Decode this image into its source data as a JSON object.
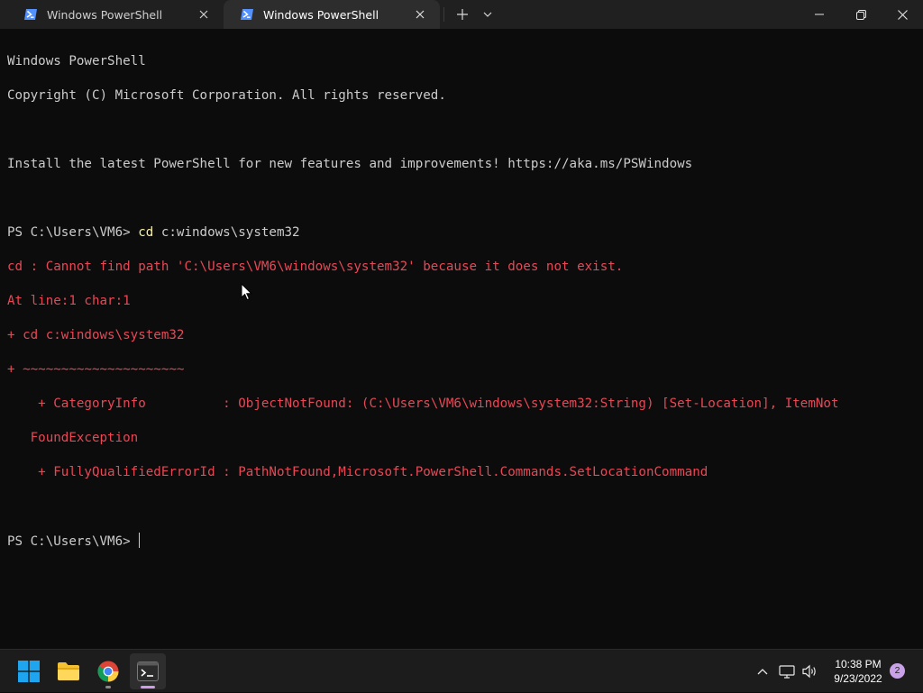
{
  "tabs": [
    {
      "title": "Windows PowerShell",
      "active": false,
      "icon": "powershell-icon"
    },
    {
      "title": "Windows PowerShell",
      "active": true,
      "icon": "powershell-icon"
    }
  ],
  "tabbar": {
    "new_tab_icon": "plus-icon",
    "dropdown_icon": "chevron-down-icon"
  },
  "window_controls": {
    "minimize_icon": "minimize-icon",
    "restore_icon": "restore-icon",
    "close_icon": "close-icon"
  },
  "terminal": {
    "header_line1": "Windows PowerShell",
    "header_line2": "Copyright (C) Microsoft Corporation. All rights reserved.",
    "install_line": "Install the latest PowerShell for new features and improvements! https://aka.ms/PSWindows",
    "prompt": "PS C:\\Users\\VM6> ",
    "cmd_keyword": "cd",
    "cmd_args": " c:windows\\system32",
    "error_line1": "cd : Cannot find path 'C:\\Users\\VM6\\windows\\system32' because it does not exist.",
    "error_line2": "At line:1 char:1",
    "error_line3": "+ cd c:windows\\system32",
    "error_line4": "+ ~~~~~~~~~~~~~~~~~~~~~",
    "error_line5": "    + CategoryInfo          : ObjectNotFound: (C:\\Users\\VM6\\windows\\system32:String) [Set-Location], ItemNot",
    "error_line6": "   FoundException",
    "error_line7": "    + FullyQualifiedErrorId : PathNotFound,Microsoft.PowerShell.Commands.SetLocationCommand",
    "final_prompt": "PS C:\\Users\\VM6> "
  },
  "colors": {
    "terminal_bg": "#0c0c0c",
    "text": "#cccccc",
    "command_yellow": "#f9f1a5",
    "error_red": "#e74856",
    "titlebar_bg": "#202020",
    "active_tab_bg": "#2d2d2d",
    "taskbar_bg": "#1c1c1c"
  },
  "taskbar": {
    "apps": [
      {
        "name": "start",
        "icon": "windows-start-icon"
      },
      {
        "name": "file-explorer",
        "icon": "folder-icon"
      },
      {
        "name": "chrome",
        "icon": "chrome-icon"
      },
      {
        "name": "terminal",
        "icon": "terminal-icon",
        "active": true
      }
    ],
    "tray_icons": [
      "chevron-up-icon",
      "network-icon",
      "volume-icon"
    ],
    "time": "10:38 PM",
    "date": "9/23/2022",
    "notification_count": "2"
  }
}
